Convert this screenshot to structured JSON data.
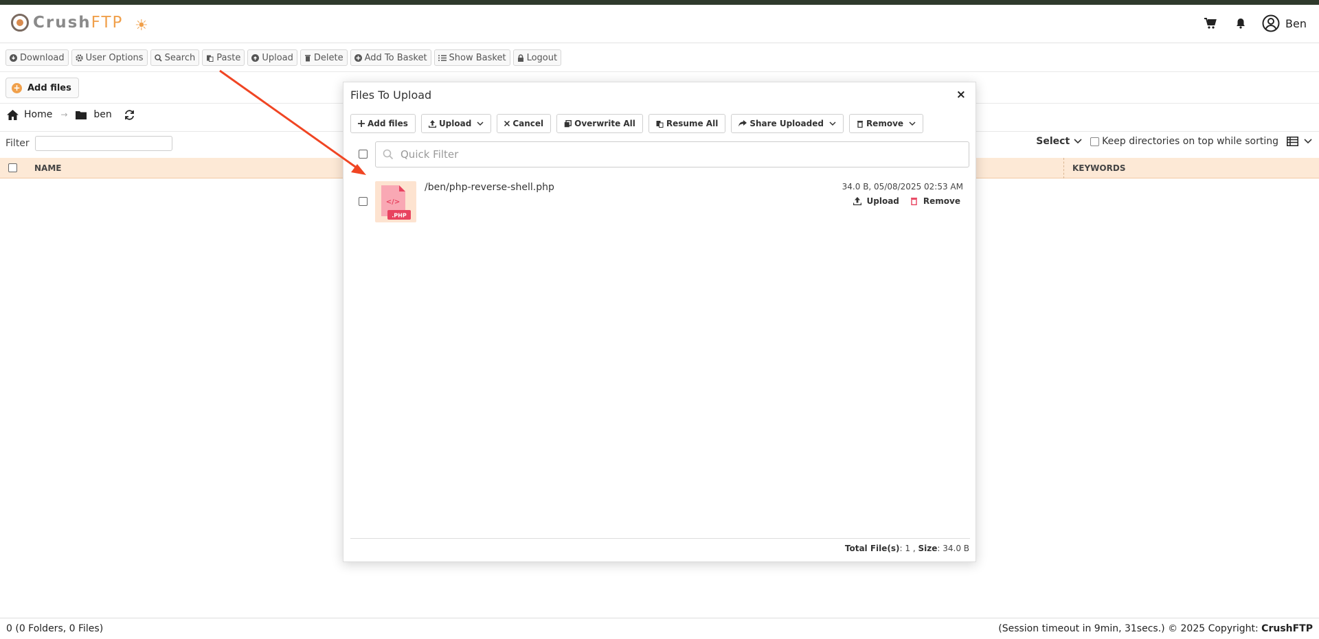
{
  "app": {
    "logo_crush": "Crush",
    "logo_ftp": "FTP",
    "user_name": "Ben"
  },
  "toolbar": {
    "download": "Download",
    "user_options": "User Options",
    "search": "Search",
    "paste": "Paste",
    "upload": "Upload",
    "delete": "Delete",
    "add_to_basket": "Add To Basket",
    "show_basket": "Show Basket",
    "logout": "Logout"
  },
  "add_files_label": "Add files",
  "breadcrumb": {
    "home": "Home",
    "folder": "ben"
  },
  "filter": {
    "label": "Filter",
    "value": ""
  },
  "list_controls": {
    "select": "Select",
    "keep_dirs_label": "Keep directories on top while sorting"
  },
  "table": {
    "col_name": "NAME",
    "col_keywords": "KEYWORDS"
  },
  "footer": {
    "left": "0 (0 Folders, 0 Files)",
    "right_prefix": "(Session timeout in 9min, 31secs.) © 2025 Copyright: ",
    "right_brand": "CrushFTP"
  },
  "modal": {
    "title": "Files To Upload",
    "close": "×",
    "buttons": {
      "add_files": "Add files",
      "upload": "Upload",
      "cancel": "Cancel",
      "overwrite_all": "Overwrite All",
      "resume_all": "Resume All",
      "share_uploaded": "Share Uploaded",
      "remove": "Remove"
    },
    "quick_filter_placeholder": "Quick Filter",
    "file": {
      "path": "/ben/php-reverse-shell.php",
      "meta": "34.0 B, 05/08/2025 02:53 AM",
      "badge": ".PHP",
      "code_glyph": "</>",
      "upload_action": "Upload",
      "remove_action": "Remove"
    },
    "totals": {
      "files_label": "Total File(s)",
      "files_value": ": 1 ,",
      "size_label": "Size",
      "size_value": ": 34.0 B"
    }
  },
  "colors": {
    "accent": "#f0a04b",
    "header_bar": "#2f3a2c",
    "table_header": "#fde9d6",
    "php_badge": "#e8435f",
    "annotation_arrow": "#f04523"
  }
}
